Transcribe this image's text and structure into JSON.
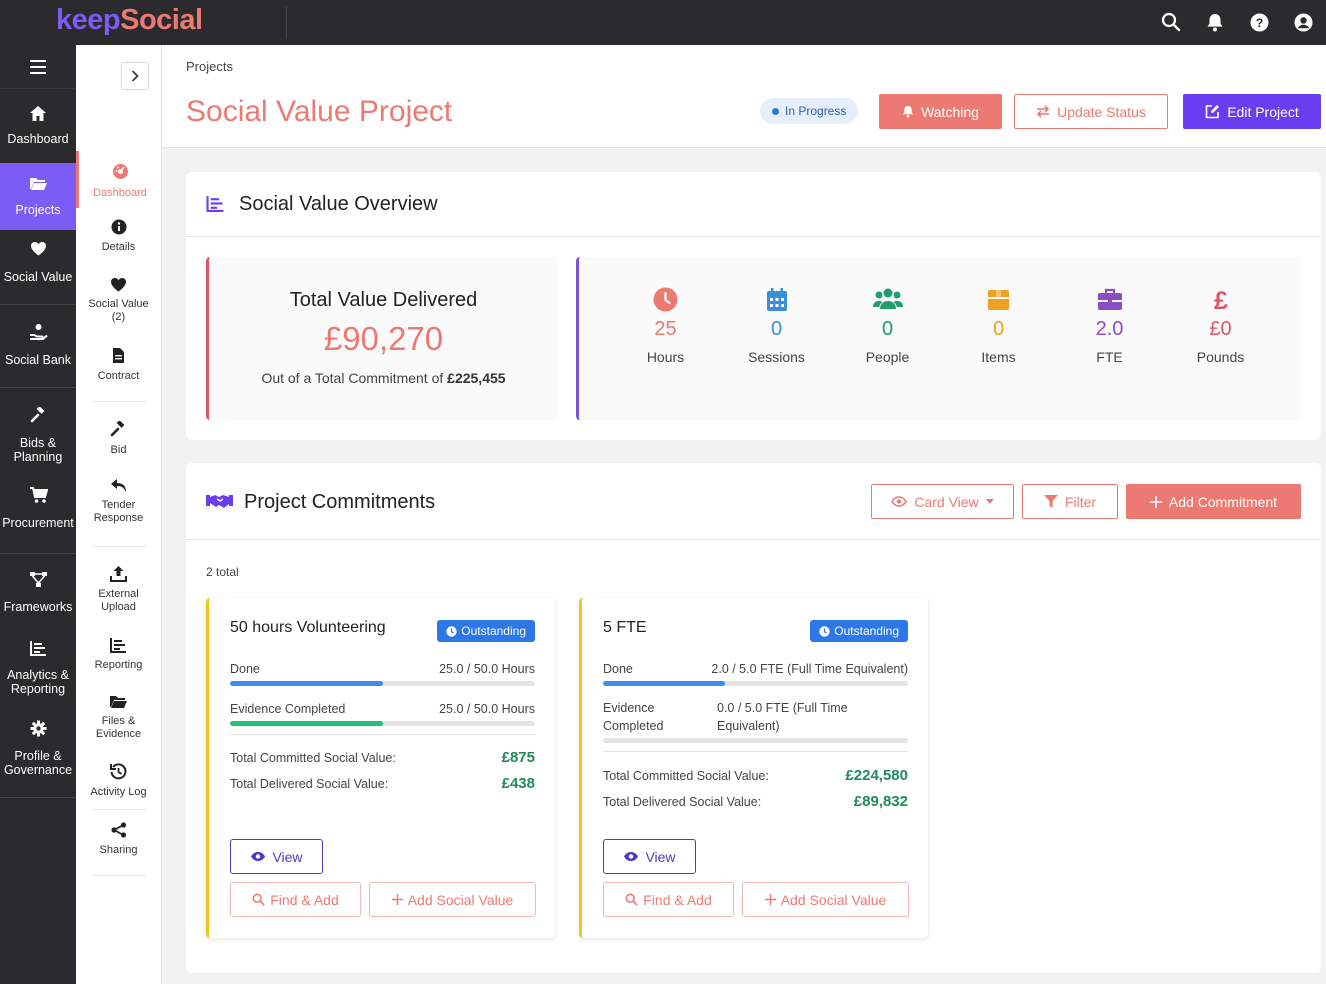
{
  "app": {
    "logo_part1": "keep",
    "logo_part2": "Social"
  },
  "colors": {
    "brand_purple": "#7b5cf5",
    "brand_coral": "#ec7a72",
    "edit_purple": "#6a3df0",
    "success_green": "#1f8a5b",
    "outstanding_blue": "#2d78e6",
    "card_border_yellow": "#f2c51f"
  },
  "topbar": {
    "icons": [
      "search-icon",
      "bell-icon",
      "help-icon",
      "user-icon"
    ]
  },
  "sidebar": {
    "items": [
      {
        "label": "Dashboard",
        "icon": "home-icon"
      },
      {
        "label": "Projects",
        "icon": "folder-open-icon"
      },
      {
        "label": "Social Value",
        "icon": "heart-icon"
      },
      {
        "label": "Social Bank",
        "icon": "hand-holding-icon"
      },
      {
        "label": "Bids &",
        "label2": "Planning",
        "icon": "gavel-icon"
      },
      {
        "label": "Procurement",
        "icon": "cart-icon"
      },
      {
        "label": "Frameworks",
        "icon": "network-icon"
      },
      {
        "label": "Analytics &",
        "label2": "Reporting",
        "icon": "chart-icon"
      },
      {
        "label": "Profile &",
        "label2": "Governance",
        "icon": "cog-icon"
      }
    ]
  },
  "subnav": {
    "items": [
      {
        "label": "Dashboard",
        "icon": "palette-icon"
      },
      {
        "label": "Details",
        "icon": "info-icon"
      },
      {
        "label": "Social Value",
        "label2": "(2)",
        "icon": "heart-icon"
      },
      {
        "label": "Contract",
        "icon": "file-contract-icon"
      },
      {
        "label": "Bid",
        "icon": "gavel-icon"
      },
      {
        "label": "Tender",
        "label2": "Response",
        "icon": "reply-icon"
      },
      {
        "label": "External",
        "label2": "Upload",
        "icon": "upload-icon"
      },
      {
        "label": "Reporting",
        "icon": "chart-icon"
      },
      {
        "label": "Files &",
        "label2": "Evidence",
        "icon": "folder-open-icon"
      },
      {
        "label": "Activity Log",
        "icon": "history-icon"
      },
      {
        "label": "Sharing",
        "icon": "share-icon"
      }
    ]
  },
  "header": {
    "breadcrumb": "Projects",
    "title": "Social Value Project",
    "status": "In Progress",
    "watch_label": "Watching",
    "update_label": "Update Status",
    "edit_label": "Edit Project"
  },
  "overview": {
    "title": "Social Value Overview",
    "total_label": "Total Value Delivered",
    "total_value": "£90,270",
    "commitment_text": "Out of a Total Commitment of",
    "commitment_value": "£225,455",
    "stats": [
      {
        "value": "25",
        "label": "Hours",
        "icon": "clock-icon",
        "color": "#ec7a72"
      },
      {
        "value": "0",
        "label": "Sessions",
        "icon": "calendar-icon",
        "color": "#3b8fd9"
      },
      {
        "value": "0",
        "label": "People",
        "icon": "users-icon",
        "color": "#1f9e6a"
      },
      {
        "value": "0",
        "label": "Items",
        "icon": "box-icon",
        "color": "#f0a020"
      },
      {
        "value": "2.0",
        "label": "FTE",
        "icon": "briefcase-icon",
        "color": "#8a4fc4"
      },
      {
        "value": "£0",
        "label": "Pounds",
        "icon": "pound-icon",
        "color": "#e0546a"
      }
    ]
  },
  "commitments": {
    "title": "Project Commitments",
    "card_view_label": "Card View",
    "filter_label": "Filter",
    "add_label": "Add Commitment",
    "total_text": "2 total",
    "cards": [
      {
        "title": "50 hours Volunteering",
        "status": "Outstanding",
        "done_label": "Done",
        "done_value": "25.0 / 50.0 Hours",
        "done_progress": 0.5,
        "evidence_label": "Evidence Completed",
        "evidence_value": "25.0 / 50.0 Hours",
        "evidence_progress": 0.5,
        "committed_label": "Total Committed Social Value:",
        "committed_value": "£875",
        "delivered_label": "Total Delivered Social Value:",
        "delivered_value": "£438",
        "view_label": "View",
        "find_label": "Find & Add",
        "add_sv_label": "Add Social Value"
      },
      {
        "title": "5 FTE",
        "status": "Outstanding",
        "done_label": "Done",
        "done_value": "2.0 / 5.0 FTE (Full Time Equivalent)",
        "done_progress": 0.4,
        "evidence_label": "Evidence",
        "evidence_label2": "Completed",
        "evidence_value": "0.0 / 5.0 FTE (Full Time",
        "evidence_value2": "Equivalent)",
        "evidence_progress": 0.0,
        "committed_label": "Total Committed Social Value:",
        "committed_value": "£224,580",
        "delivered_label": "Total Delivered Social Value:",
        "delivered_value": "£89,832",
        "view_label": "View",
        "find_label": "Find & Add",
        "add_sv_label": "Add Social Value"
      }
    ]
  }
}
